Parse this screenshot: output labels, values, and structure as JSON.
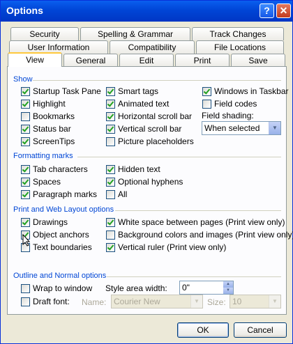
{
  "window": {
    "title": "Options",
    "help_glyph": "?",
    "close_glyph": "✕"
  },
  "tabs": {
    "row1": [
      "Security",
      "Spelling & Grammar",
      "Track Changes"
    ],
    "row2": [
      "User Information",
      "Compatibility",
      "File Locations"
    ],
    "row3": [
      "View",
      "General",
      "Edit",
      "Print",
      "Save"
    ],
    "active": "View"
  },
  "show": {
    "title": "Show",
    "col1": [
      {
        "label": "Startup Task Pane",
        "checked": true
      },
      {
        "label": "Highlight",
        "checked": true
      },
      {
        "label": "Bookmarks",
        "checked": false
      },
      {
        "label": "Status bar",
        "checked": true
      },
      {
        "label": "ScreenTips",
        "checked": true
      }
    ],
    "col2": [
      {
        "label": "Smart tags",
        "checked": true
      },
      {
        "label": "Animated text",
        "checked": true
      },
      {
        "label": "Horizontal scroll bar",
        "checked": true
      },
      {
        "label": "Vertical scroll bar",
        "checked": true
      },
      {
        "label": "Picture placeholders",
        "checked": false
      }
    ],
    "col3": [
      {
        "label": "Windows in Taskbar",
        "checked": true
      },
      {
        "label": "Field codes",
        "checked": false
      }
    ],
    "field_shading_label": "Field shading:",
    "field_shading_value": "When selected"
  },
  "formatting_marks": {
    "title": "Formatting marks",
    "col1": [
      {
        "label": "Tab characters",
        "checked": true
      },
      {
        "label": "Spaces",
        "checked": true
      },
      {
        "label": "Paragraph marks",
        "checked": true
      }
    ],
    "col2": [
      {
        "label": "Hidden text",
        "checked": true
      },
      {
        "label": "Optional hyphens",
        "checked": true
      },
      {
        "label": "All",
        "checked": false
      }
    ]
  },
  "print_web": {
    "title": "Print and Web Layout options",
    "col1": [
      {
        "label": "Drawings",
        "checked": true
      },
      {
        "label": "Object anchors",
        "checked": true
      },
      {
        "label": "Text boundaries",
        "checked": false
      }
    ],
    "col2": [
      {
        "label": "White space between pages (Print view only)",
        "checked": true
      },
      {
        "label": "Background colors and images (Print view only)",
        "checked": false
      },
      {
        "label": "Vertical ruler (Print view only)",
        "checked": true
      }
    ]
  },
  "outline": {
    "title": "Outline and Normal options",
    "wrap": {
      "label": "Wrap to window",
      "checked": false
    },
    "draft": {
      "label": "Draft font:",
      "checked": false
    },
    "style_width_label": "Style area width:",
    "style_width_value": "0\"",
    "name_label": "Name:",
    "name_value": "Courier New",
    "size_label": "Size:",
    "size_value": "10"
  },
  "buttons": {
    "ok": "OK",
    "cancel": "Cancel"
  },
  "icons": {
    "help": "help-icon",
    "close": "close-icon",
    "dropdown": "chevron-down-icon",
    "spin": "spin-arrows-icon",
    "cursor": "mouse-pointer-icon"
  }
}
